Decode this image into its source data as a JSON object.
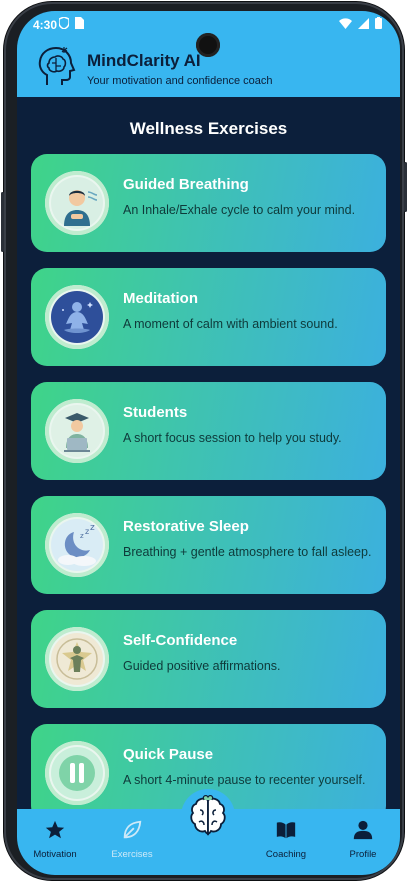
{
  "status_bar": {
    "time": "4:30"
  },
  "header": {
    "title": "MindClarity AI",
    "subtitle": "Your motivation and confidence coach"
  },
  "section_title": "Wellness Exercises",
  "exercises": [
    {
      "title": "Guided Breathing",
      "description": "An Inhale/Exhale cycle to calm your mind.",
      "icon": "breathing-person-icon"
    },
    {
      "title": "Meditation",
      "description": "A moment of calm with ambient sound.",
      "icon": "meditation-icon"
    },
    {
      "title": "Students",
      "description": "A short focus session to help you study.",
      "icon": "student-icon"
    },
    {
      "title": "Restorative Sleep",
      "description": "Breathing + gentle atmosphere to fall asleep.",
      "icon": "moon-sleep-icon"
    },
    {
      "title": "Self-Confidence",
      "description": "Guided positive affirmations.",
      "icon": "confident-person-icon"
    },
    {
      "title": "Quick Pause",
      "description": "A short 4-minute pause to recenter yourself.",
      "icon": "pause-icon"
    }
  ],
  "bottom_nav": {
    "items": [
      {
        "label": "Motivation",
        "icon": "star-icon"
      },
      {
        "label": "Exercises",
        "icon": "leaf-icon"
      },
      {
        "label": "Coaching",
        "icon": "book-icon"
      },
      {
        "label": "Profile",
        "icon": "person-icon"
      }
    ],
    "center_icon": "brain-icon"
  },
  "colors": {
    "header_bg": "#38b6f0",
    "screen_bg": "#0c1f3b",
    "card_gradient_start": "#3fd488",
    "card_gradient_end": "#3cb0de"
  }
}
